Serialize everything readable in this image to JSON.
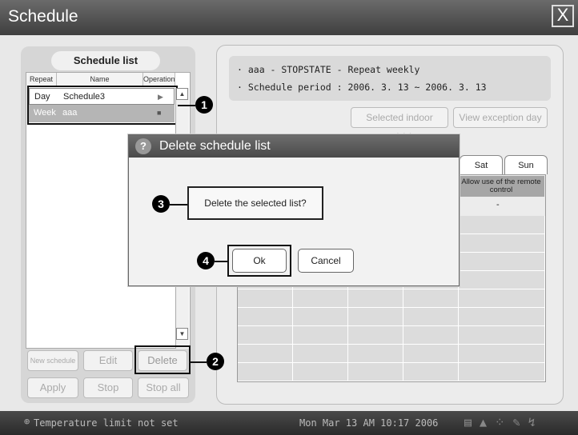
{
  "window": {
    "title": "Schedule",
    "close_label": "X"
  },
  "schedule_list": {
    "title": "Schedule list",
    "columns": [
      "Repeat",
      "Name",
      "Operation"
    ],
    "rows": [
      {
        "repeat": "Day",
        "name": "Schedule3",
        "operation": "▶"
      },
      {
        "repeat": "Week",
        "name": "aaa",
        "operation": "■"
      }
    ]
  },
  "buttons": {
    "new_schedule": "New schedule",
    "edit": "Edit",
    "delete": "Delete",
    "apply": "Apply",
    "stop": "Stop",
    "stop_all": "Stop all"
  },
  "info": {
    "line1": "· aaa - STOPSTATE - Repeat weekly",
    "line2": "· Schedule period : 2006. 3. 13 ~ 2006. 3. 13"
  },
  "right_buttons": {
    "selected_units": "Selected indoor unit(s)",
    "view_exception": "View exception day"
  },
  "tabs": [
    "Sat",
    "Sun"
  ],
  "grid": {
    "header": "Allow use of the remote control",
    "first_value": "-"
  },
  "dialog": {
    "title": "Delete schedule list",
    "message": "Delete the selected list?",
    "ok": "Ok",
    "cancel": "Cancel"
  },
  "callouts": [
    "1",
    "2",
    "3",
    "4"
  ],
  "status": {
    "message": "Temperature limit not set",
    "clock": "Mon Mar 13 AM 10:17 2006"
  }
}
